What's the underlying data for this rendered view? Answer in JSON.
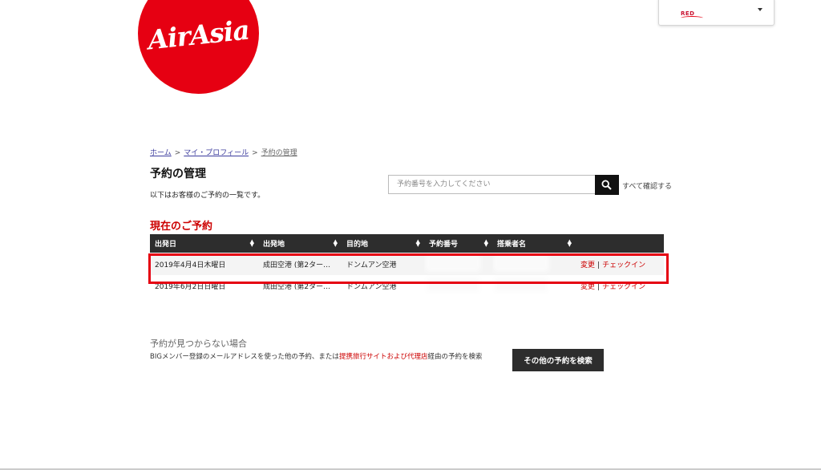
{
  "brand": {
    "logo_text": "AirAsia",
    "logo_color": "#e60012"
  },
  "account_menu": {
    "badge": "RED"
  },
  "breadcrumb": {
    "home": "ホーム",
    "profile": "マイ・プロフィール",
    "current": "予約の管理",
    "separator": ">"
  },
  "page": {
    "title": "予約の管理",
    "subtitle": "以下はお客様のご予約の一覧です。"
  },
  "search": {
    "placeholder": "予約番号を入力してください",
    "view_all": "すべて確認する",
    "icon": "search-icon"
  },
  "reservations": {
    "section_title": "現在のご予約",
    "headers": [
      "出発日",
      "出発地",
      "目的地",
      "予約番号",
      "搭乗者名",
      ""
    ],
    "rows": [
      {
        "date": "2019年4月4日木曜日",
        "origin": "成田空港 (第2ターミ…",
        "destination": "ドンムアン空港",
        "change": "変更",
        "checkin": "チェックイン"
      },
      {
        "date": "2019年6月2日日曜日",
        "origin": "成田空港 (第2ターミ…",
        "destination": "ドンムアン空港",
        "change": "変更",
        "checkin": "チェックイン"
      }
    ],
    "action_separator": "|"
  },
  "not_found": {
    "title": "予約が見つからない場合",
    "text_before": "BIGメンバー登録のメールアドレスを使った他の予約、または",
    "partner_link": "提携旅行サイトおよび代理店",
    "text_after": "経由の予約を検索",
    "button": "その他の予約を検索"
  },
  "colors": {
    "accent": "#cc0000",
    "header_bg": "#2d2d2d",
    "highlight": "#e50012"
  }
}
